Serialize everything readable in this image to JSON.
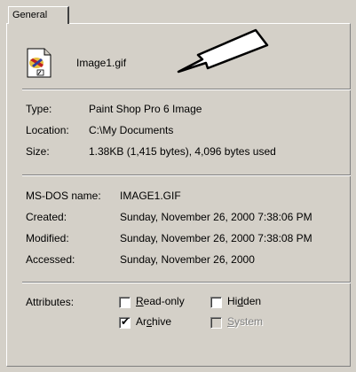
{
  "tab": {
    "label": "General"
  },
  "file": {
    "name": "Image1.gif"
  },
  "details": [
    {
      "label": "Type:",
      "value": "Paint Shop Pro 6 Image"
    },
    {
      "label": "Location:",
      "value": "C:\\My Documents"
    },
    {
      "label": "Size:",
      "value": "1.38KB (1,415 bytes), 4,096 bytes used"
    }
  ],
  "dates": [
    {
      "label": "MS-DOS name:",
      "value": "IMAGE1.GIF"
    },
    {
      "label": "Created:",
      "value": "Sunday, November 26, 2000 7:38:06 PM"
    },
    {
      "label": "Modified:",
      "value": "Sunday, November 26, 2000 7:38:08 PM"
    },
    {
      "label": "Accessed:",
      "value": "Sunday, November 26, 2000"
    }
  ],
  "attributes": {
    "label": "Attributes:",
    "read_only": {
      "label_pre": "",
      "label_key": "R",
      "label_post": "ead-only",
      "checked": false
    },
    "hidden": {
      "label_pre": "Hi",
      "label_key": "d",
      "label_post": "den",
      "checked": false
    },
    "archive": {
      "label_pre": "Ar",
      "label_key": "c",
      "label_post": "hive",
      "checked": true
    },
    "system": {
      "label_pre": "",
      "label_key": "S",
      "label_post": "ystem",
      "checked": false
    }
  }
}
